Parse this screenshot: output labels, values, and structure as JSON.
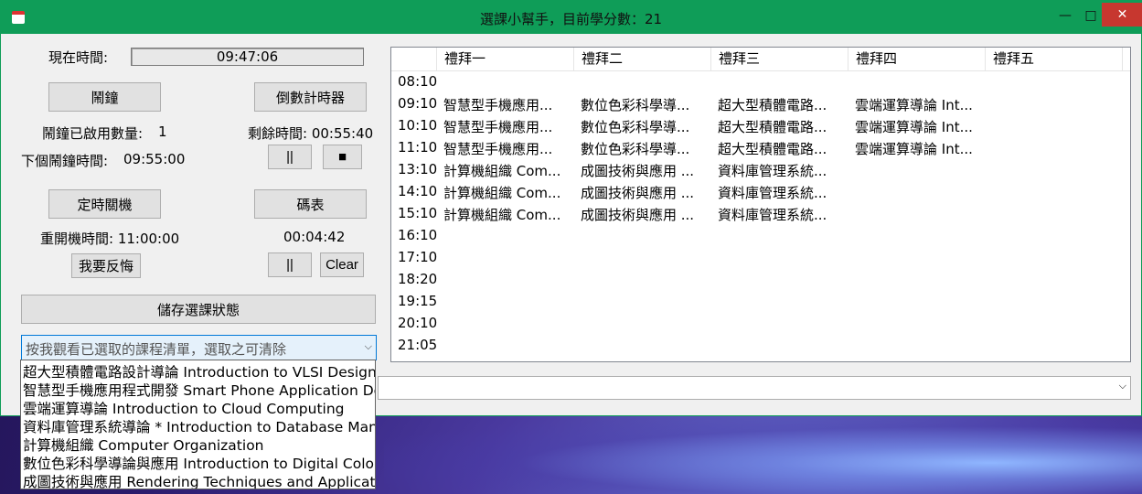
{
  "window": {
    "title": "選課小幫手，目前學分數：21",
    "minimize": "—",
    "maximize": "□",
    "close": "✕"
  },
  "clock": {
    "label": "現在時間:",
    "value": "09:47:06"
  },
  "alarm": {
    "button": "鬧鐘",
    "count_label": "鬧鐘已啟用數量:",
    "count_value": "1",
    "next_label": "下個鬧鐘時間:",
    "next_value": "09:55:00"
  },
  "countdown": {
    "button": "倒數計時器",
    "remaining": "剩餘時間: 00:55:40",
    "pause": "||",
    "stop": "■"
  },
  "shutdown": {
    "button": "定時關機",
    "restart": "重開機時間: 11:00:00",
    "regret": "我要反悔"
  },
  "stopwatch": {
    "button": "碼表",
    "value": "00:04:42",
    "pause": "||",
    "clear": "Clear"
  },
  "save_button": "儲存選課狀態",
  "course_combo": {
    "placeholder": "按我觀看已選取的課程清單，選取之可清除",
    "options": [
      "超大型積體電路設計導論  Introduction to VLSI Design",
      "智慧型手機應用程式開發  Smart Phone Application Development",
      "雲端運算導論  Introduction to Cloud Computing",
      "資料庫管理系統導論 * Introduction to Database Management Systems",
      "計算機組織  Computer Organization",
      "數位色彩科學導論與應用  Introduction to Digital Color Science",
      "成圖技術與應用  Rendering Techniques and Applications"
    ]
  },
  "schedule": {
    "days": [
      "禮拜一",
      "禮拜二",
      "禮拜三",
      "禮拜四",
      "禮拜五"
    ],
    "times": [
      "08:10",
      "09:10",
      "10:10",
      "11:10",
      "13:10",
      "14:10",
      "15:10",
      "16:10",
      "17:10",
      "18:20",
      "19:15",
      "20:10",
      "21:05"
    ],
    "rows": [
      [
        "",
        "",
        "",
        "",
        ""
      ],
      [
        "智慧型手機應用...",
        "數位色彩科學導...",
        "超大型積體電路...",
        "雲端運算導論  Int...",
        ""
      ],
      [
        "智慧型手機應用...",
        "數位色彩科學導...",
        "超大型積體電路...",
        "雲端運算導論  Int...",
        ""
      ],
      [
        "智慧型手機應用...",
        "數位色彩科學導...",
        "超大型積體電路...",
        "雲端運算導論  Int...",
        ""
      ],
      [
        "計算機組織  Com...",
        "成圖技術與應用  ...",
        "資料庫管理系統...",
        "",
        ""
      ],
      [
        "計算機組織  Com...",
        "成圖技術與應用  ...",
        "資料庫管理系統...",
        "",
        ""
      ],
      [
        "計算機組織  Com...",
        "成圖技術與應用  ...",
        "資料庫管理系統...",
        "",
        ""
      ]
    ]
  },
  "colors": {
    "titlebar": "#0f9d58",
    "close": "#c7372f",
    "selection_border": "#0078d7"
  }
}
